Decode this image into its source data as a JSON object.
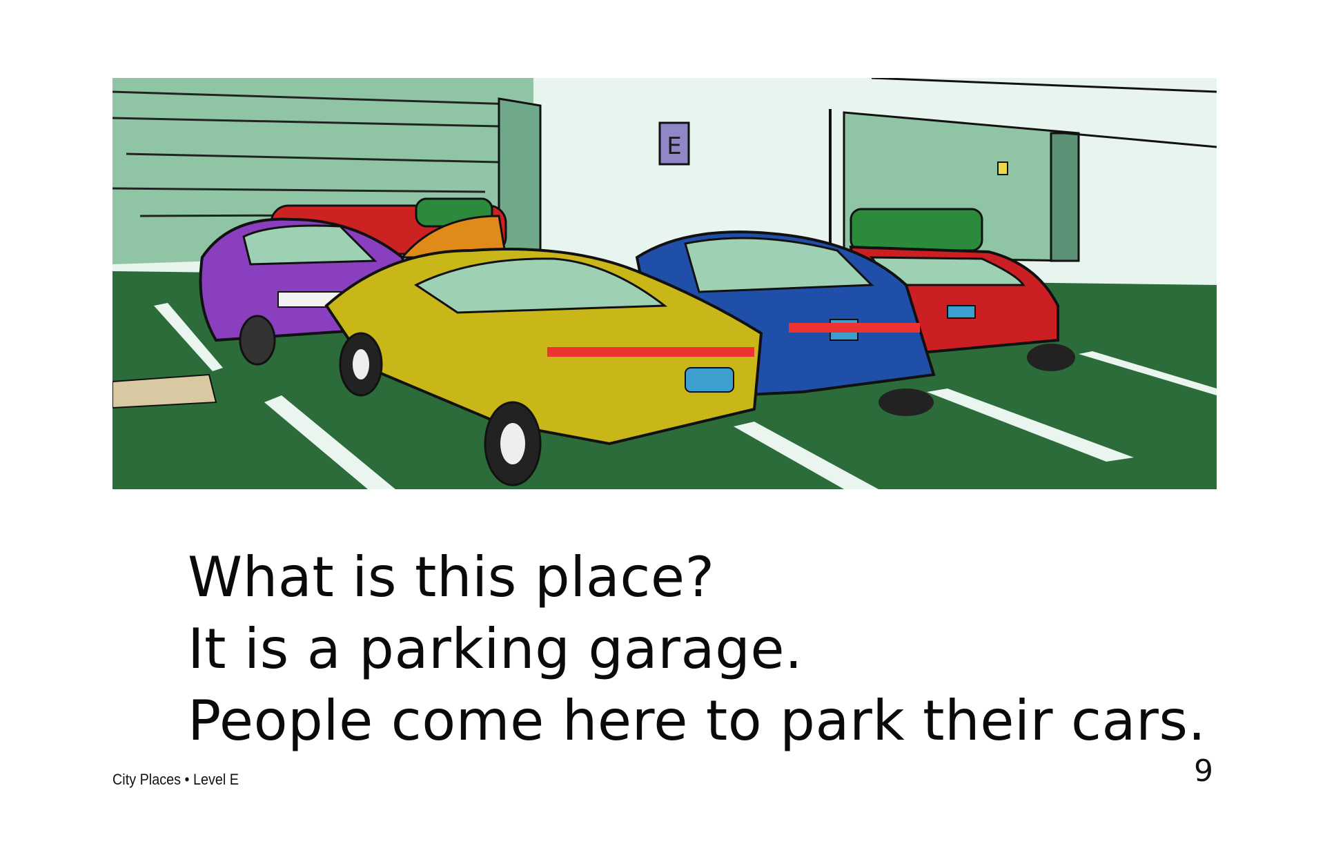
{
  "illustration": {
    "description_icon": "parking-garage-illustration",
    "sign_letter": "E",
    "colors": {
      "wall": "#e6f2ec",
      "wall_shadow": "#8ec3a4",
      "floor": "#2c6b3a",
      "parking_lines": "#e9f5ee",
      "purple_car": "#8a3fbf",
      "yellow_car": "#c9b619",
      "blue_car": "#1f4fa8",
      "red_car": "#cc1f24",
      "orange_car": "#e08a1a",
      "sign": "#8f87c7"
    }
  },
  "text": {
    "lines": [
      "What is this place?",
      "It is a parking garage.",
      "People come here to park their cars."
    ]
  },
  "footer": {
    "book_title": "City Places • Level E",
    "page_number": "9"
  }
}
